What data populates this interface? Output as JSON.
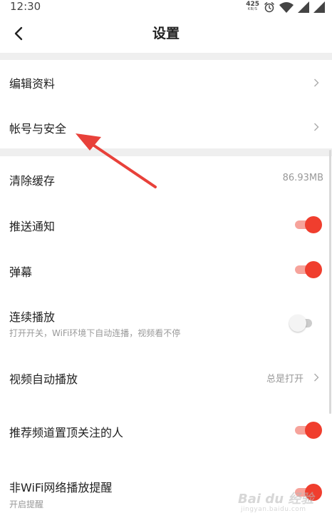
{
  "status_bar": {
    "time": "12:30",
    "net_speed_value": "425",
    "net_speed_unit": "KB/S",
    "icons": [
      "alarm-icon",
      "wifi-icon",
      "signal-icon",
      "signal-icon"
    ]
  },
  "header": {
    "title": "设置",
    "back_icon": "back-arrow-icon"
  },
  "items": {
    "edit_profile": {
      "label": "编辑资料"
    },
    "account_security": {
      "label": "帐号与安全"
    },
    "clear_cache": {
      "label": "清除缓存",
      "value": "86.93MB"
    },
    "push_notify": {
      "label": "推送通知",
      "toggle": "on"
    },
    "danmaku": {
      "label": "弹幕",
      "toggle": "on"
    },
    "continuous_play": {
      "label": "连续播放",
      "subtitle": "打开开关，WiFi环境下自动连播，视频看不停",
      "toggle": "off"
    },
    "autoplay": {
      "label": "视频自动播放",
      "value": "总是打开"
    },
    "pin_followed": {
      "label": "推荐频道置顶关注的人",
      "toggle": "on"
    },
    "non_wifi_reminder": {
      "label": "非WiFi网络播放提醒",
      "subtitle": "开启提醒",
      "toggle": "on"
    }
  },
  "colors": {
    "accent": "#f03e2e",
    "accent_track": "#f6a39b",
    "annotation_arrow": "#e8413a",
    "section_gap": "#efefef",
    "secondary_text": "#999999"
  },
  "watermark": {
    "logo": "Bai du 经验",
    "sub": "jingyan.baidu.com"
  }
}
